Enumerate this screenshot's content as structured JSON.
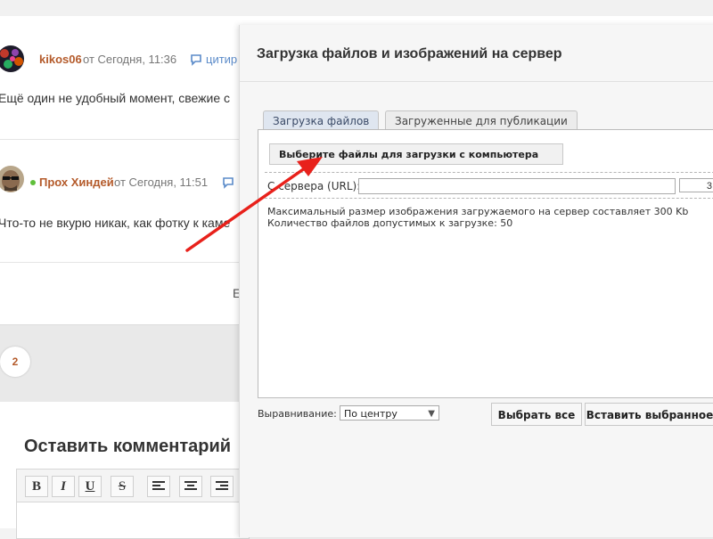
{
  "comments": [
    {
      "author": "kikos06",
      "meta": "от Сегодня, 11:36",
      "quote": "цитир",
      "text": "Ещё один не удобный момент, свежие с"
    },
    {
      "author": "Прох Хиндей",
      "meta": "от Сегодня, 11:51",
      "text": "Что-то не вкурю никак, как фотку к каме"
    }
  ],
  "partial_letter": "Е",
  "pager": {
    "current": "2"
  },
  "leave_comment": {
    "title": "Оставить комментарий",
    "toolbar": {
      "bold": "B",
      "italic": "I",
      "underline": "U",
      "strike": "S"
    }
  },
  "modal": {
    "title": "Загрузка файлов и изображений на сервер",
    "tabs": [
      {
        "label": "Загрузка файлов",
        "active": true
      },
      {
        "label": "Загруженные для публикации",
        "active": false
      }
    ],
    "choose_button": "Выберите файлы для загрузки с компьютера",
    "url_label": "С сервера (URL):",
    "url_value": "",
    "url_extra": "3",
    "info_lines": [
      "Максимальный размер изображения загружаемого на сервер составляет 300 Kb",
      "Количество файлов допустимых к загрузке: 50"
    ],
    "align_label": "Выравнивание:",
    "align_selected": "По центру",
    "select_all": "Выбрать все",
    "insert_selected": "Вставить выбранное"
  },
  "colors": {
    "author": "#b45a2a",
    "accent": "#5b8bc9",
    "arrow": "#e8211b",
    "online": "#5fbf3a"
  }
}
